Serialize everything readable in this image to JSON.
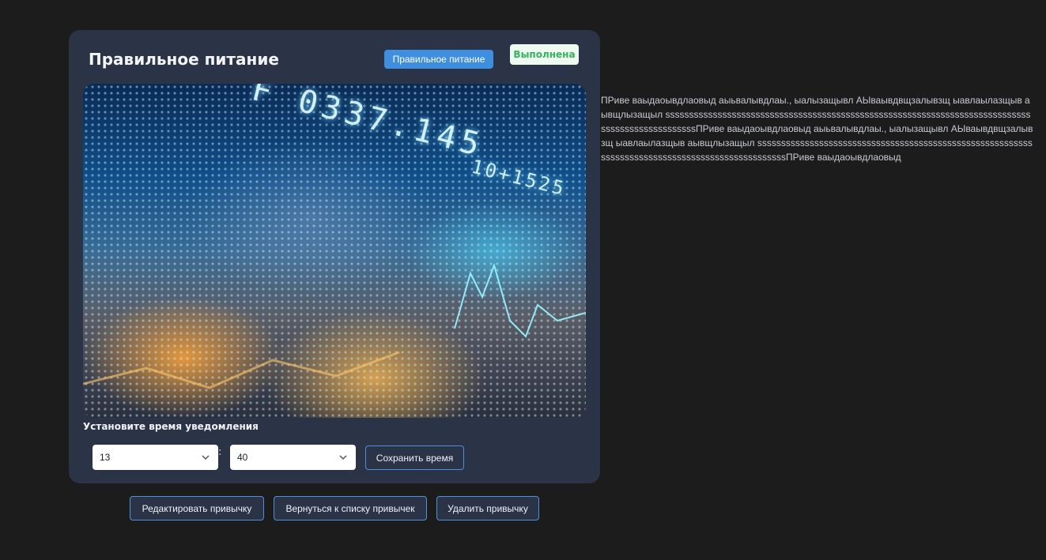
{
  "habit": {
    "title": "Правильное питание",
    "category": "Правильное питание",
    "status": "Выполнена",
    "image_icon": "stock-market-ticker-image"
  },
  "notification": {
    "label": "Установите время уведомления",
    "hour": "13",
    "separator": ":",
    "minute": "40",
    "save_label": "Сохранить время"
  },
  "actions": {
    "edit_label": "Редактировать привычку",
    "back_label": "Вернуться к списку привычек",
    "delete_label": "Удалить привычку"
  },
  "description": "ПРиве ваыдаоывдлаовыд аыьвалывдлаы., ыалызащывл АЫваывдвщзалывзщ ыавлаылазщыв аывщлызащыл sssssssssssssssssssssssssssssssssssssssssssssssssssssssssssssssssssssssssssssssssssssssssssssssssПРиве ваыдаоывдлаовыд аыьвалывдлаы., ыалызащывл АЫваывдвщзалывзщ ыавлаылазщыв аывщлызащыл sssssssssssssssssssssssssssssssssssssssssssssssssssssssssssssssssssssssssssssssssssssssssssssssssПРиве ваыдаоывдлаовыд",
  "colors": {
    "page_bg": "#1c1c1c",
    "card_bg": "#2b3447",
    "accent": "#3f8ee0",
    "status_text": "#37b25f",
    "status_bg": "#eefaf1"
  }
}
